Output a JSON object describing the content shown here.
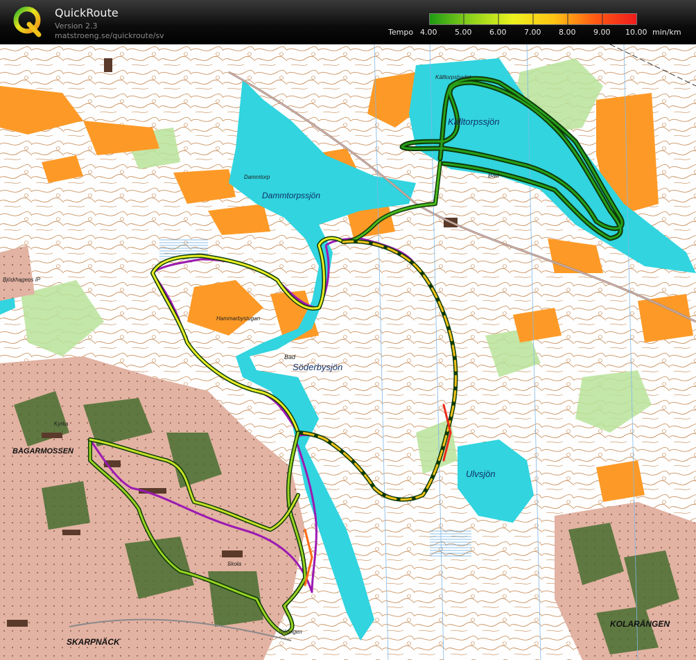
{
  "app": {
    "title": "QuickRoute",
    "version": "Version 2.3",
    "url": "matstroeng.se/quickroute/sv",
    "logo_letter": "Q"
  },
  "legend": {
    "label": "Tempo",
    "unit": "min/km",
    "ticks": [
      "4.00",
      "5.00",
      "6.00",
      "7.00",
      "8.00",
      "9.00",
      "10.00"
    ],
    "gradient_colors": [
      "#1e9a14",
      "#8ed21c",
      "#ecf21e",
      "#ffc414",
      "#ff5a14",
      "#ee1c1c"
    ]
  },
  "map": {
    "colors": {
      "water": "#31d4df",
      "open_land": "#fd9a27",
      "green": "#b3df8f",
      "urban": "#e7b0a4",
      "contour": "#a25a1f",
      "route_fast": "#197d0e",
      "planned_course": "#9b1ab2"
    },
    "labels": {
      "lake_kalltorp": "Källtorpssjön",
      "bath_kalltorp": "Källtorpsbadet",
      "bath_1": "Bad",
      "place_dammtorp": "Dammtorp",
      "lake_dammtorp": "Dammtorpssjön",
      "restaurant": "Hammarbystugan",
      "bath_2": "Bad",
      "lake_soderby": "Söderbysjön",
      "lake_ulv": "Ulvsjön",
      "district_bagarmossen": "BAGARMOSSEN",
      "district_skarpnack": "SKARPNÄCK",
      "district_kolarangen": "KOLARÄNGEN",
      "sport_field": "Björkhagens IP",
      "church": "Kyrka",
      "school": "Skola",
      "farm": "Sjöängen"
    }
  }
}
